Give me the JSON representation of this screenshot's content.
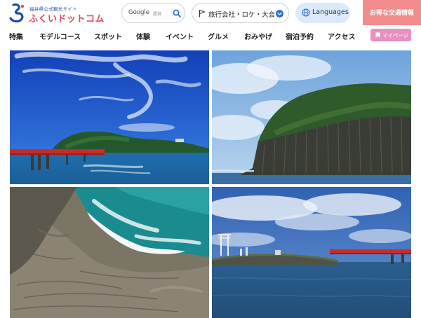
{
  "header": {
    "logo": {
      "subtitle": "福井県公式観光サイト",
      "title": "ふくいドットコム"
    },
    "search": {
      "brand": "Google",
      "placeholder": "提供"
    },
    "business": {
      "label": "旅行会社・ロケ・大会"
    },
    "languages": {
      "label": "Languages"
    },
    "deal": {
      "label": "お得な交通情報"
    }
  },
  "nav": {
    "items": [
      {
        "label": "特集"
      },
      {
        "label": "モデルコース"
      },
      {
        "label": "スポット"
      },
      {
        "label": "体験"
      },
      {
        "label": "イベント"
      },
      {
        "label": "グルメ"
      },
      {
        "label": "おみやげ"
      },
      {
        "label": "宿泊予約"
      },
      {
        "label": "アクセス"
      }
    ],
    "mypage_label": "マイページ"
  },
  "gallery": {
    "photos": [
      {
        "subject": "red-bridge-island"
      },
      {
        "subject": "columnar-cliff"
      },
      {
        "subject": "rocky-coast-waves"
      },
      {
        "subject": "torii-island-bridge"
      }
    ]
  },
  "colors": {
    "brand_red": "#e6455c",
    "brand_blue": "#1b4f9c",
    "deal_bg": "#f28b8b",
    "lang_bg": "#dbe9f9",
    "mypage_bg": "#e98fc2",
    "accent_blue": "#2f6fd1"
  }
}
